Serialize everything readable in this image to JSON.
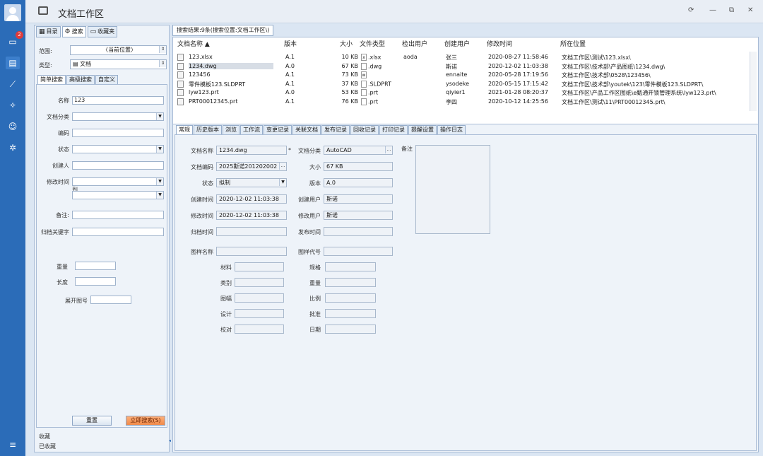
{
  "rail": {
    "badge": "2"
  },
  "window": {
    "title": "文档工作区",
    "controls": [
      "⟳",
      "—",
      "⧉",
      "✕"
    ]
  },
  "left": {
    "tabs": [
      {
        "label": "目录",
        "icon": "list-icon"
      },
      {
        "label": "搜索",
        "icon": "search-icon"
      },
      {
        "label": "收藏夹",
        "icon": "folder-icon"
      }
    ],
    "scope_label": "范围:",
    "scope_value": "〈当前位置〉",
    "type_label": "类型:",
    "type_value": "文档",
    "search_tabs": [
      "简单搜索",
      "高级搜索",
      "自定义"
    ],
    "fields": {
      "name_label": "名称",
      "name_value": "123",
      "category_label": "文档分类",
      "code_label": "编码",
      "status_label": "状态",
      "creator_label": "创建人",
      "modtime_label": "修改时间",
      "to_label": "到",
      "note_label": "备注:",
      "archive_kw_label": "归档关键字",
      "weight_label": "重量",
      "length_label": "长度",
      "unfold_label": "展开图号"
    },
    "reset_label": "重置",
    "search_label": "立即搜索(S)",
    "footer_items": [
      "收藏",
      "已收藏"
    ]
  },
  "results": {
    "tab_label": "搜索结果:9条(搜索位置:文档工作区\\)",
    "columns": [
      "文档名称",
      "版本",
      "大小",
      "文件类型",
      "检出用户",
      "创建用户",
      "修改时间",
      "所在位置"
    ],
    "rows": [
      {
        "name": "123.xlsx",
        "version": "A.1",
        "size": "10 KB",
        "ftype": ".xlsx",
        "ticon": "x",
        "checkout": "aoda",
        "creator": "张三",
        "mtime": "2020-08-27 11:58:46",
        "location": "文档工作区\\测试\\123.xlsx\\"
      },
      {
        "name": "1234.dwg",
        "version": "A.0",
        "size": "67 KB",
        "ftype": ".dwg",
        "ticon": "",
        "checkout": "",
        "creator": "斯诺",
        "mtime": "2020-12-02 11:03:38",
        "location": "文档工作区\\技术部\\产品图纸\\1234.dwg\\"
      },
      {
        "name": "123456",
        "version": "A.1",
        "size": "73 KB",
        "ftype": "",
        "ticon": "w",
        "checkout": "",
        "creator": "ennaite",
        "mtime": "2020-05-28 17:19:56",
        "location": "文档工作区\\技术部\\0528\\123456\\"
      },
      {
        "name": "零件模板123.SLDPRT",
        "version": "A.1",
        "size": "37 KB",
        "ftype": ".SLDPRT",
        "ticon": "",
        "checkout": "",
        "creator": "ysodeke",
        "mtime": "2020-05-15 17:15:42",
        "location": "文档工作区\\技术部\\youtek\\123\\零件模板123.SLDPRT\\"
      },
      {
        "name": "lyw123.prt",
        "version": "A.0",
        "size": "53 KB",
        "ftype": ".prt",
        "ticon": "",
        "checkout": "",
        "creator": "qiyier1",
        "mtime": "2021-01-28 08:20:37",
        "location": "文档工作区\\产品工作区图纸\\e甄通开锁管理系统\\lyw123.prt\\"
      },
      {
        "name": "PRT00012345.prt",
        "version": "A.1",
        "size": "76 KB",
        "ftype": ".prt",
        "ticon": "",
        "checkout": "",
        "creator": "李四",
        "mtime": "2020-10-12 14:25:56",
        "location": "文档工作区\\测试\\11\\PRT00012345.prt\\"
      }
    ]
  },
  "detail": {
    "tabs": [
      "常规",
      "历史版本",
      "浏览",
      "工作流",
      "变更记录",
      "关联文档",
      "发布记录",
      "回收记录",
      "打印记录",
      "提醒设置",
      "操作日志"
    ],
    "doc_name_label": "文档名称",
    "doc_name_value": "1234.dwg",
    "doc_cat_label": "文档分类",
    "doc_cat_value": "AutoCAD",
    "note_label": "备注",
    "doc_code_label": "文档编码",
    "doc_code_value": "2025斯诺201202002",
    "size_label": "大小",
    "size_value": "67 KB",
    "status_label": "状态",
    "status_value": "拟制",
    "version_label": "版本",
    "version_value": "A.0",
    "ctime_label": "创建时间",
    "ctime_value": "2020-12-02 11:03:38",
    "cuser_label": "创建用户",
    "cuser_value": "斯诺",
    "mtime_label": "修改时间",
    "mtime_value": "2020-12-02 11:03:38",
    "muser_label": "修改用户",
    "muser_value": "斯诺",
    "atime_label": "归档时间",
    "ptime_label": "发布时间",
    "drawing_name_label": "图样名称",
    "drawing_code_label": "图样代号",
    "material_label": "材料",
    "spec_label": "规格",
    "class_label": "类别",
    "weight_label": "重量",
    "sheet_label": "图幅",
    "scale_label": "比例",
    "design_label": "设计",
    "approve_label": "批准",
    "check_label": "校对",
    "date_label": "日期"
  }
}
